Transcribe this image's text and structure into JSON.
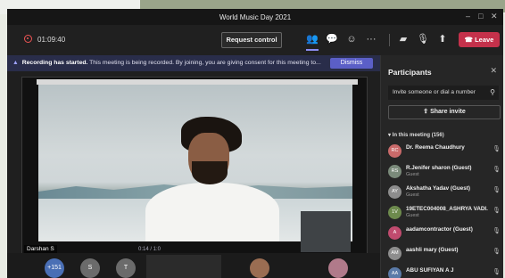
{
  "window": {
    "title": "World Music Day 2021"
  },
  "toolbar": {
    "timer": "01:09:40",
    "request_control": "Request control",
    "leave": "Leave",
    "icons": [
      "participants-icon",
      "chat-icon",
      "reactions-icon",
      "more-icon",
      "camera-off-icon",
      "mic-off-icon",
      "share-tray-icon",
      "phone-icon"
    ]
  },
  "banner": {
    "bold": "Recording has started.",
    "text": " This meeting is being recorded. By joining, you are giving consent for this meeting to...",
    "dismiss": "Dismiss"
  },
  "stage": {
    "presenter_name": "Darshan S",
    "playbar_text": "0:14 / 1:0"
  },
  "bottom_tiles": {
    "overflow_count": "+151",
    "avatars": [
      "S",
      "T"
    ]
  },
  "panel": {
    "title": "Participants",
    "invite_placeholder": "Invite someone or dial a number",
    "share_invite": "Share invite",
    "in_meeting": "In this meeting (156)",
    "participants": [
      {
        "initials": "RC",
        "name": "Dr. Reema Chaudhury",
        "role": "",
        "color": "#c96a6a"
      },
      {
        "initials": "RS",
        "name": "R.Jenifer sharon (Guest)",
        "role": "Guest",
        "color": "#7a8a7a"
      },
      {
        "initials": "AY",
        "name": "Akshatha Yadav (Guest)",
        "role": "Guest",
        "color": "#8d8d8d"
      },
      {
        "initials": "1V",
        "name": "19ETEC004008_ASHRYA VADI...",
        "role": "Guest",
        "color": "#6d8a4d"
      },
      {
        "initials": "A",
        "name": "aadamcontractor (Guest)",
        "role": "",
        "color": "#c04b6e"
      },
      {
        "initials": "AM",
        "name": "aashli mary (Guest)",
        "role": "",
        "color": "#8d8d8d"
      },
      {
        "initials": "AA",
        "name": "ABU SUFIYAN A J",
        "role": "",
        "color": "#5a7aa8"
      }
    ]
  },
  "colors": {
    "leave": "#c4314b",
    "accent": "#5b5fc7",
    "banner": "#292d4a"
  }
}
